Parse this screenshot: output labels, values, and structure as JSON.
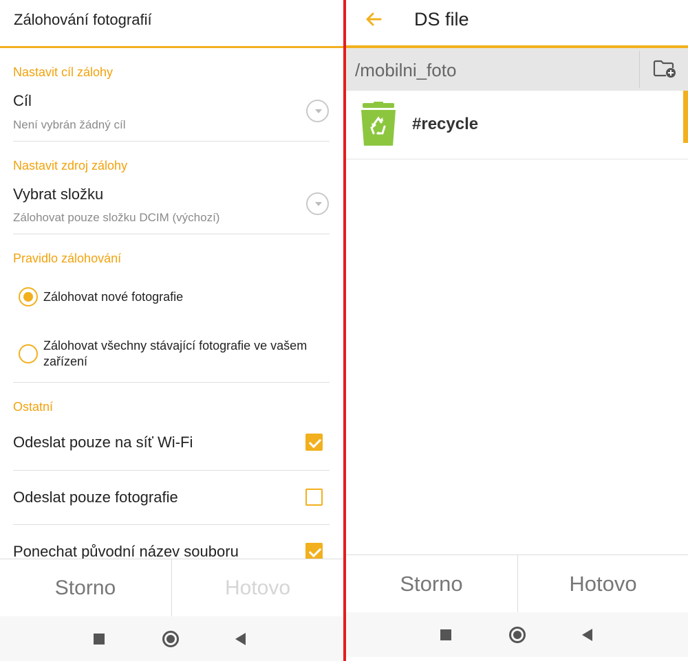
{
  "colors": {
    "accent": "#f2b01e",
    "divider_red": "#e31e1e",
    "recycle_green": "#8cc63f"
  },
  "left": {
    "title": "Zálohování fotografií",
    "destination": {
      "section_label": "Nastavit cíl zálohy",
      "title": "Cíl",
      "subtitle": "Není vybrán žádný cíl"
    },
    "source": {
      "section_label": "Nastavit zdroj zálohy",
      "title": "Vybrat složku",
      "subtitle": "Zálohovat pouze složku DCIM (výchozí)"
    },
    "rule": {
      "section_label": "Pravidlo zálohování",
      "options": [
        {
          "label": "Zálohovat nové fotografie",
          "selected": true
        },
        {
          "label": "Zálohovat všechny stávající fotografie ve vašem zařízení",
          "selected": false
        }
      ]
    },
    "other": {
      "section_label": "Ostatní",
      "options": [
        {
          "label": "Odeslat pouze na síť Wi-Fi",
          "checked": true
        },
        {
          "label": "Odeslat pouze fotografie",
          "checked": false
        },
        {
          "label": "Ponechat původní název souboru",
          "checked": true
        }
      ]
    },
    "footer": {
      "cancel_label": "Storno",
      "done_label": "Hotovo"
    }
  },
  "right": {
    "title": "DS file",
    "path": "/mobilni_foto",
    "items": [
      {
        "name": "#recycle",
        "icon": "recycle-bin-icon"
      }
    ],
    "footer": {
      "cancel_label": "Storno",
      "done_label": "Hotovo"
    }
  },
  "navbar_icons": [
    "recents-square-icon",
    "home-circle-icon",
    "back-triangle-icon"
  ]
}
